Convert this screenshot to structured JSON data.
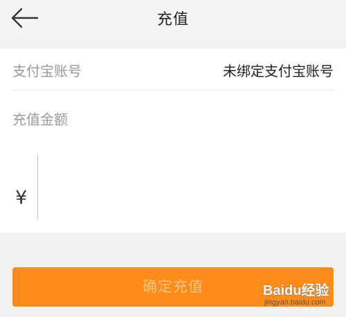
{
  "header": {
    "title": "充值",
    "back_icon": "arrow-left-icon"
  },
  "account": {
    "label": "支付宝账号",
    "value": "未绑定支付宝账号"
  },
  "amount": {
    "label": "充值金额",
    "currency_symbol": "¥",
    "value": ""
  },
  "confirm": {
    "label": "确定充值"
  },
  "colors": {
    "accent": "#ff8c1a",
    "button_text_disabled": "#ffc48a",
    "background": "#f2f2f2"
  },
  "watermark": {
    "logo": "Baidu经验",
    "url": "jingyan.baidu.com"
  }
}
